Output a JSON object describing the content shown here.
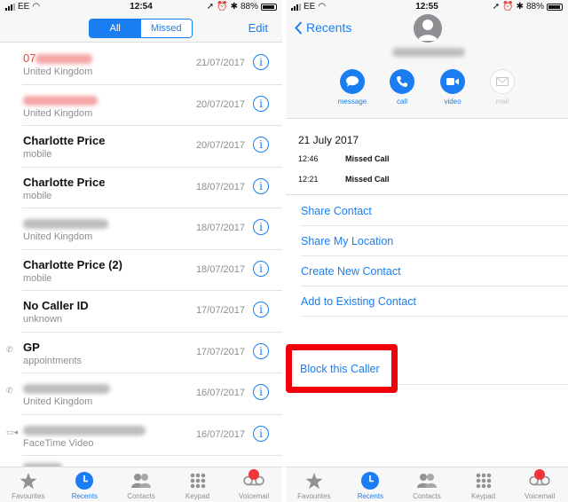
{
  "left": {
    "status": {
      "carrier": "EE",
      "time": "12:54",
      "battery": "88%"
    },
    "segment": {
      "all": "All",
      "missed": "Missed",
      "selected": "All"
    },
    "edit_label": "Edit",
    "calls": [
      {
        "name": "07",
        "name_redacted": true,
        "missed": true,
        "sub": "United Kingdom",
        "date": "21/07/2017",
        "type_icon": ""
      },
      {
        "name": "",
        "name_redacted": true,
        "missed": true,
        "sub": "United Kingdom",
        "date": "20/07/2017",
        "type_icon": ""
      },
      {
        "name": "Charlotte Price",
        "missed": false,
        "sub": "mobile",
        "date": "20/07/2017",
        "type_icon": ""
      },
      {
        "name": "Charlotte Price",
        "missed": false,
        "sub": "mobile",
        "date": "18/07/2017",
        "type_icon": ""
      },
      {
        "name": "",
        "name_redacted": true,
        "missed": false,
        "sub": "United Kingdom",
        "date": "18/07/2017",
        "type_icon": ""
      },
      {
        "name": "Charlotte Price (2)",
        "missed": false,
        "sub": "mobile",
        "date": "18/07/2017",
        "type_icon": ""
      },
      {
        "name": "No Caller ID",
        "missed": false,
        "sub": "unknown",
        "date": "17/07/2017",
        "type_icon": ""
      },
      {
        "name": "GP",
        "missed": false,
        "sub": "appointments",
        "date": "17/07/2017",
        "type_icon": "outgoing-call"
      },
      {
        "name": "",
        "name_redacted": true,
        "missed": false,
        "sub": "United Kingdom",
        "date": "16/07/2017",
        "type_icon": "outgoing-call"
      },
      {
        "name": "",
        "name_redacted": true,
        "missed": false,
        "sub": "FaceTime Video",
        "date": "16/07/2017",
        "type_icon": "facetime-video"
      }
    ]
  },
  "tabs": [
    {
      "label": "Favourites",
      "icon": "star-icon"
    },
    {
      "label": "Recents",
      "icon": "clock-icon",
      "active": true
    },
    {
      "label": "Contacts",
      "icon": "contacts-icon"
    },
    {
      "label": "Keypad",
      "icon": "keypad-icon"
    },
    {
      "label": "Voicemail",
      "icon": "voicemail-icon",
      "badge": true
    }
  ],
  "right": {
    "status": {
      "carrier": "EE",
      "time": "12:55",
      "battery": "88%"
    },
    "back_label": "Recents",
    "actions": [
      {
        "label": "message",
        "enabled": true
      },
      {
        "label": "call",
        "enabled": true
      },
      {
        "label": "video",
        "enabled": true
      },
      {
        "label": "mail",
        "enabled": false
      }
    ],
    "date_heading": "21 July 2017",
    "call_log": [
      {
        "time": "12:46",
        "kind": "Missed Call"
      },
      {
        "time": "12:21",
        "kind": "Missed Call"
      }
    ],
    "options": [
      "Share Contact",
      "Share My Location",
      "Create New Contact",
      "Add to Existing Contact"
    ],
    "block_label": "Block this Caller",
    "highlight_color": "#f0000a"
  },
  "colors": {
    "accent": "#1a7ef2",
    "missed": "#e8453c",
    "badge": "#f2353a"
  }
}
